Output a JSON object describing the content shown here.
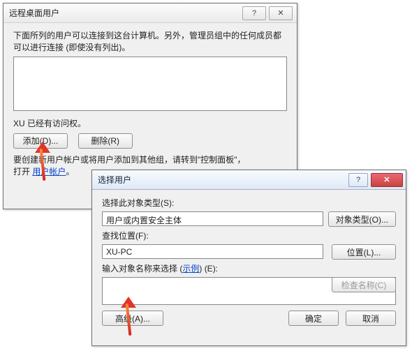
{
  "dlg1": {
    "title": "远程桌面用户",
    "intro": "下面所列的用户可以连接到这台计算机。另外，管理员组中的任何成员都可以进行连接 (即使没有列出)。",
    "access_line": "XU 已经有访问权。",
    "add_btn": "添加(D)...",
    "remove_btn": "删除(R)",
    "footer_a": "要创建新用户帐户或将用户添加到其他组，请转到\"控制面板\"，",
    "footer_b_prefix": "打开 ",
    "footer_link": "用户帐户",
    "footer_b_suffix": "。"
  },
  "dlg2": {
    "title": "选择用户",
    "obj_type_label": "选择此对象类型(S):",
    "obj_type_value": "用户或内置安全主体",
    "obj_type_btn": "对象类型(O)...",
    "loc_label": "查找位置(F):",
    "loc_value": "XU-PC",
    "loc_btn": "位置(L)...",
    "name_label_pre": "输入对象名称来选择 (",
    "name_label_link": "示例",
    "name_label_post": ") (E):",
    "check_btn": "检查名称(C)",
    "advanced_btn": "高级(A)...",
    "ok_btn": "确定",
    "cancel_btn": "取消"
  }
}
